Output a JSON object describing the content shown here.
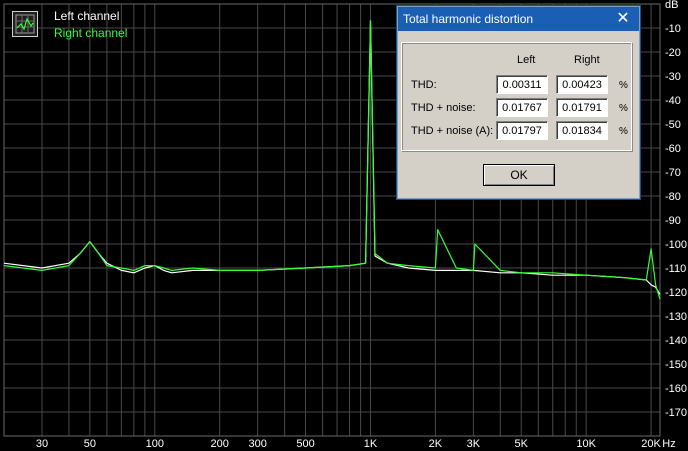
{
  "legend": {
    "left_label": "Left channel",
    "right_label": "Right channel",
    "icon": "spectrum-analyzer-icon"
  },
  "chart_data": {
    "type": "line",
    "title": "",
    "xlabel": "Hz",
    "ylabel": "dB",
    "xscale": "log",
    "xlim": [
      20,
      22000
    ],
    "ylim": [
      -180,
      0
    ],
    "grid": true,
    "x_tick_labels": [
      "30",
      "50",
      "100",
      "200",
      "300",
      "500",
      "1K",
      "2K",
      "3K",
      "5K",
      "10K",
      "20K",
      "Hz"
    ],
    "y_tick_labels": [
      "dB",
      "-10",
      "-20",
      "-30",
      "-40",
      "-50",
      "-60",
      "-70",
      "-80",
      "-90",
      "-100",
      "-110",
      "-120",
      "-130",
      "-140",
      "-150",
      "-160",
      "-170"
    ],
    "series": [
      {
        "name": "Left channel",
        "color": "#ffffff",
        "x": [
          20,
          30,
          40,
          45,
          50,
          55,
          60,
          70,
          80,
          90,
          100,
          110,
          120,
          150,
          200,
          300,
          500,
          800,
          950,
          1000,
          1050,
          1200,
          1500,
          2000,
          2500,
          3000,
          4000,
          5000,
          7000,
          10000,
          15000,
          19000,
          20000,
          21000,
          22000
        ],
        "y": [
          -108,
          -110,
          -108,
          -104,
          -99,
          -104,
          -108,
          -111,
          -112,
          -110,
          -109,
          -111,
          -112,
          -111,
          -111,
          -111,
          -110,
          -109,
          -108,
          -7,
          -105,
          -108,
          -110,
          -111,
          -111,
          -111,
          -112,
          -112,
          -113,
          -113,
          -114,
          -115,
          -117,
          -118,
          -121
        ]
      },
      {
        "name": "Right channel",
        "color": "#33ff33",
        "x": [
          20,
          30,
          40,
          45,
          50,
          55,
          60,
          70,
          80,
          90,
          100,
          110,
          120,
          150,
          200,
          300,
          500,
          800,
          950,
          1000,
          1050,
          1200,
          1500,
          2000,
          2050,
          2500,
          3000,
          3050,
          4000,
          5000,
          7000,
          10000,
          15000,
          19000,
          20000,
          21000,
          22000
        ],
        "y": [
          -109,
          -111,
          -109,
          -104,
          -99,
          -104,
          -109,
          -110,
          -111,
          -109,
          -109,
          -110,
          -111,
          -110,
          -111,
          -111,
          -110,
          -109,
          -108,
          -7,
          -104,
          -108,
          -109,
          -110,
          -94,
          -110,
          -111,
          -100,
          -111,
          -112,
          -112,
          -113,
          -114,
          -115,
          -102,
          -117,
          -123
        ]
      }
    ]
  },
  "dialog": {
    "title": "Total harmonic distortion",
    "close_glyph": "✕",
    "col_left": "Left",
    "col_right": "Right",
    "unit": "%",
    "ok_label": "OK",
    "rows": [
      {
        "label": "THD:",
        "left": "0.00311",
        "right": "0.00423"
      },
      {
        "label": "THD + noise:",
        "left": "0.01767",
        "right": "0.01791"
      },
      {
        "label": "THD + noise (A):",
        "left": "0.01797",
        "right": "0.01834"
      }
    ]
  }
}
